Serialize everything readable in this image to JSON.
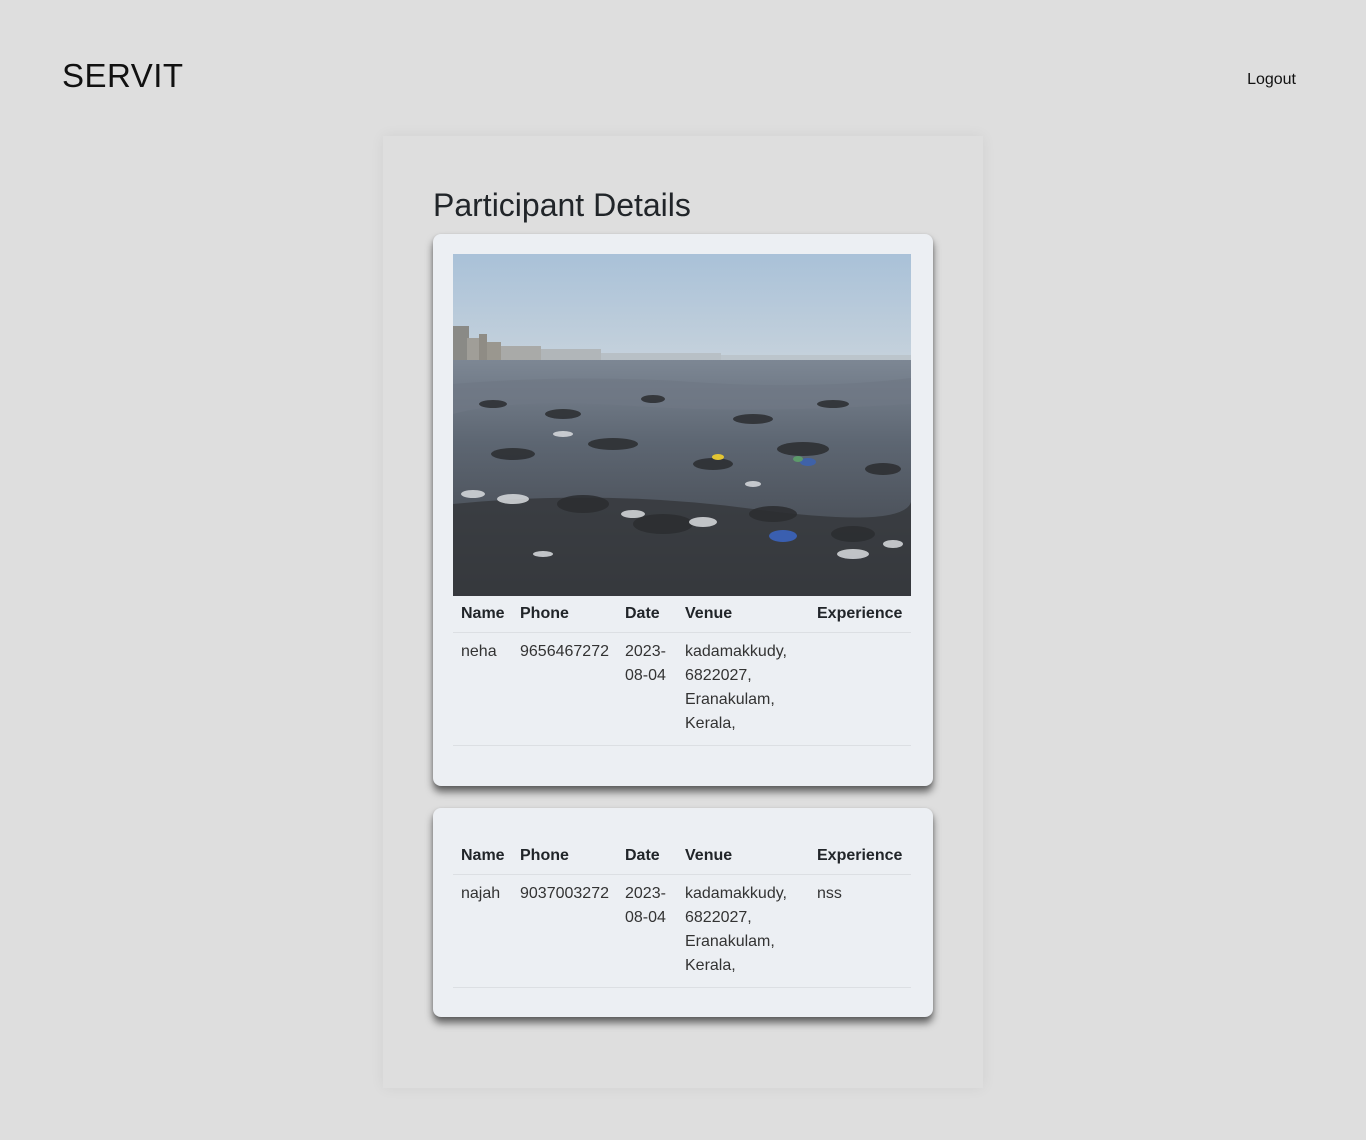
{
  "brand": "SERVIT",
  "nav": {
    "logout": "Logout"
  },
  "page_title": "Participant Details",
  "table_headers": {
    "name": "Name",
    "phone": "Phone",
    "date": "Date",
    "venue": "Venue",
    "experience": "Experience"
  },
  "participants": [
    {
      "name": "neha",
      "phone": "9656467272",
      "date": "2023-08-04",
      "venue": "kadamakkudy, 6822027, Eranakulam, Kerala,",
      "experience": ""
    },
    {
      "name": "najah",
      "phone": "9037003272",
      "date": "2023-08-04",
      "venue": "kadamakkudy, 6822027, Eranakulam, Kerala,",
      "experience": "nss"
    }
  ],
  "colors": {
    "background": "#dedede",
    "card": "#eceff3",
    "text": "#212529"
  }
}
